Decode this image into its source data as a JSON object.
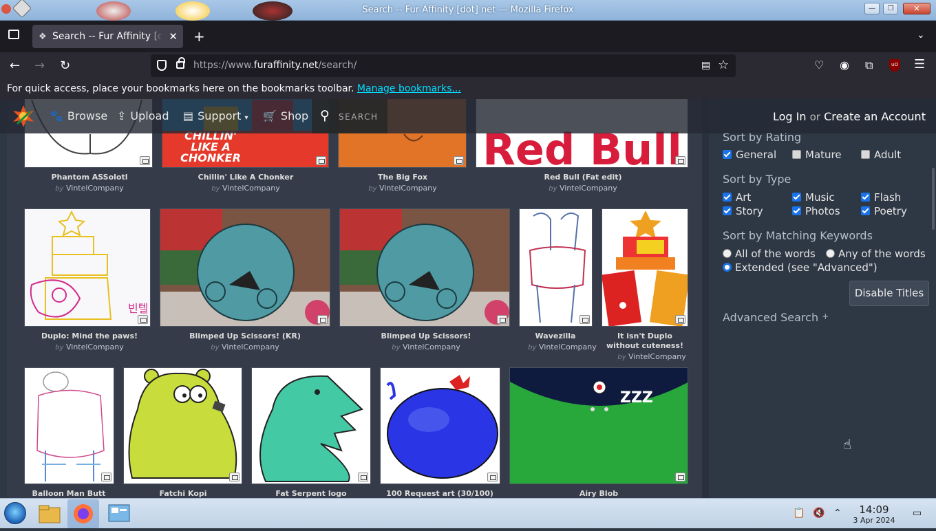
{
  "window": {
    "title": "Search -- Fur Affinity [dot] net — Mozilla Firefox"
  },
  "tabs": [
    {
      "label": "Search -- Fur Affinity [dot] net"
    }
  ],
  "navbar": {
    "url_prefix": "https://www.",
    "url_domain": "furaffinity.net",
    "url_path": "/search/"
  },
  "bookmarks": {
    "message": "For quick access, place your bookmarks here on the bookmarks toolbar.",
    "link": "Manage bookmarks..."
  },
  "fa_header": {
    "browse": "Browse",
    "upload": "Upload",
    "support": "Support",
    "shop": "Shop",
    "search": "SEARCH",
    "login": "Log In",
    "or": "or",
    "create": "Create an Account"
  },
  "gallery": {
    "by_prefix": "by",
    "items": [
      {
        "title": "Phantom ASSolotl",
        "artist": "VintelCompany"
      },
      {
        "title": "Chillin' Like A Chonker",
        "artist": "VintelCompany"
      },
      {
        "title": "The Big Fox",
        "artist": "VintelCompany"
      },
      {
        "title": "Red Bull (Fat edit)",
        "artist": "VintelCompany"
      },
      {
        "title": "Duplo: Mind the paws!",
        "artist": "VintelCompany"
      },
      {
        "title": "Blimped Up Scissors! (KR)",
        "artist": "VintelCompany"
      },
      {
        "title": "Blimped Up Scissors!",
        "artist": "VintelCompany"
      },
      {
        "title": "Wavezilla",
        "artist": "VintelCompany"
      },
      {
        "title": "It isn't Duplo without cuteness!",
        "artist": "VintelCompany"
      },
      {
        "title": "Balloon Man Butt",
        "artist": ""
      },
      {
        "title": "Fatchi Kopi",
        "artist": ""
      },
      {
        "title": "Fat Serpent logo",
        "artist": ""
      },
      {
        "title": "100 Request art (30/100)",
        "artist": ""
      },
      {
        "title": "Airy Blob",
        "artist": ""
      }
    ],
    "thumb_texts": {
      "chonker_line1": "CHILLIN'",
      "chonker_line2": "LIKE A",
      "chonker_line3": "CHONKER",
      "redbull": "Red Bull",
      "zzz": "ZZZ"
    }
  },
  "sidebar": {
    "rating": {
      "heading": "Sort by Rating",
      "options": [
        {
          "label": "General",
          "checked": true
        },
        {
          "label": "Mature",
          "checked": false
        },
        {
          "label": "Adult",
          "checked": false
        }
      ]
    },
    "type": {
      "heading": "Sort by Type",
      "options": [
        {
          "label": "Art",
          "checked": true
        },
        {
          "label": "Music",
          "checked": true
        },
        {
          "label": "Flash",
          "checked": true
        },
        {
          "label": "Story",
          "checked": true
        },
        {
          "label": "Photos",
          "checked": true
        },
        {
          "label": "Poetry",
          "checked": true
        }
      ]
    },
    "keywords": {
      "heading": "Sort by Matching Keywords",
      "options": [
        {
          "label": "All of the words",
          "selected": false
        },
        {
          "label": "Any of the words",
          "selected": false
        },
        {
          "label": "Extended (see \"Advanced\")",
          "selected": true
        }
      ]
    },
    "disable_titles": "Disable Titles",
    "advanced": "Advanced Search",
    "advanced_suffix": "+"
  },
  "taskbar": {
    "time": "14:09",
    "date": "3 Apr 2024"
  },
  "colors": {
    "page_bg": "#353b48",
    "sidebar_bg": "#2e3744",
    "accent_checkbox": "#1a73e8",
    "link": "#00ddff"
  }
}
